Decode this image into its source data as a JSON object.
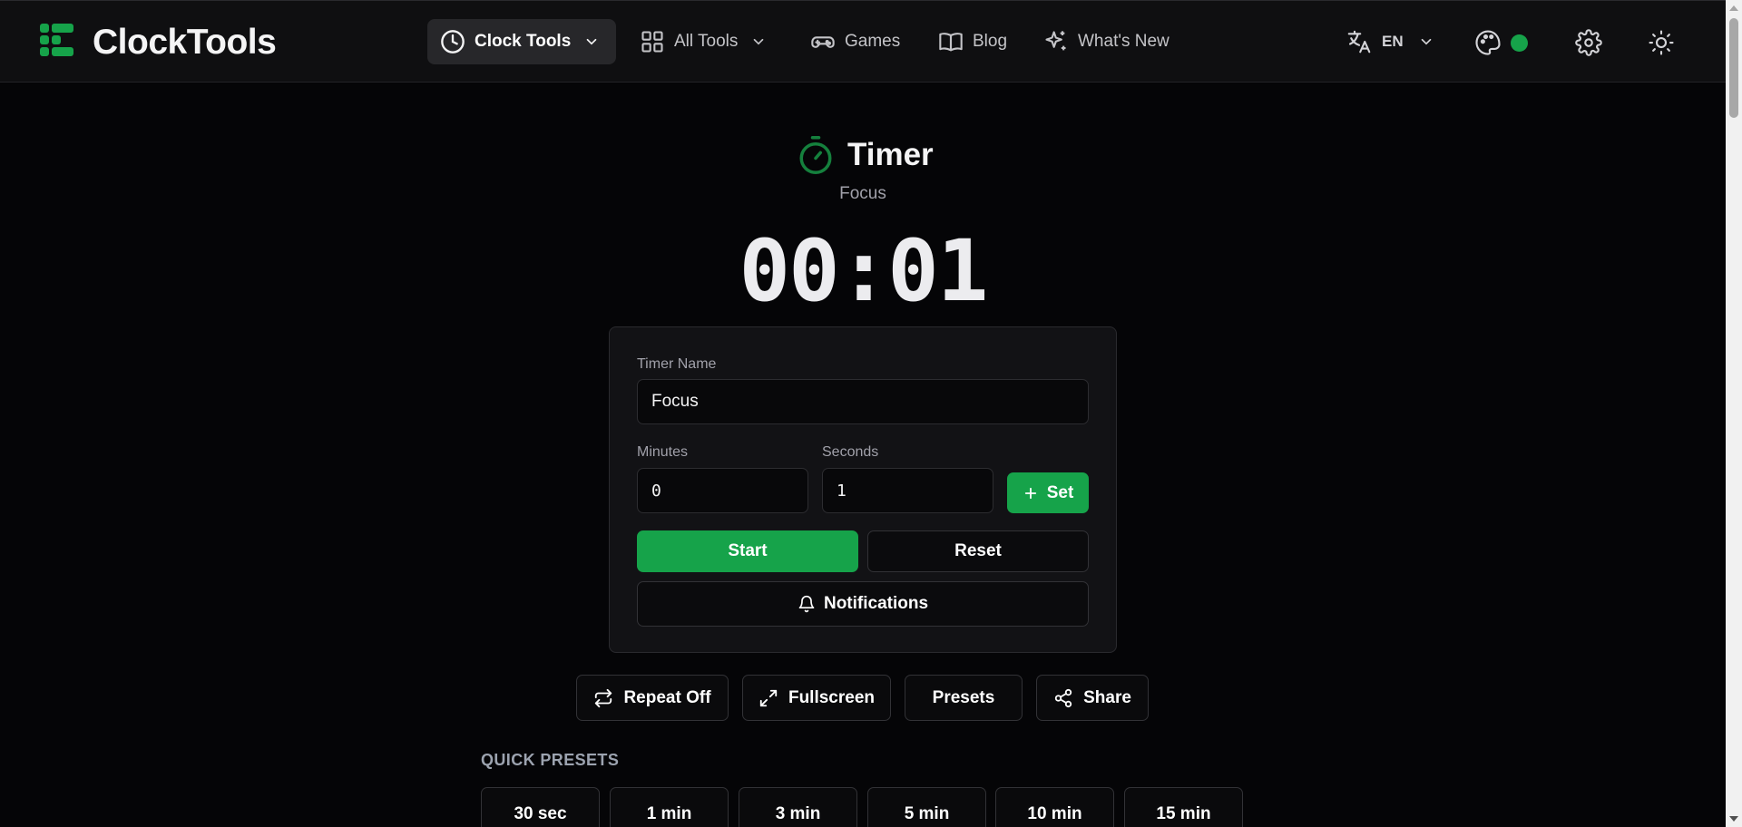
{
  "app": {
    "brand": "ClockTools",
    "accent_color": "#16a34a"
  },
  "nav": {
    "clock_tools": "Clock Tools",
    "all_tools": "All Tools",
    "games": "Games",
    "blog": "Blog",
    "whats_new": "What's New"
  },
  "header_right": {
    "language": "EN",
    "status_color": "#16a34a"
  },
  "timer": {
    "title": "Timer",
    "subtitle": "Focus",
    "display": "00:01"
  },
  "form": {
    "timer_name_label": "Timer Name",
    "timer_name_value": "Focus",
    "minutes_label": "Minutes",
    "minutes_value": "0",
    "seconds_label": "Seconds",
    "seconds_value": "1",
    "set_label": "Set",
    "start_label": "Start",
    "reset_label": "Reset",
    "notifications_label": "Notifications"
  },
  "actions": {
    "repeat": "Repeat Off",
    "fullscreen": "Fullscreen",
    "presets": "Presets",
    "share": "Share"
  },
  "quick_presets": {
    "title": "QUICK PRESETS",
    "items": [
      "30 sec",
      "1 min",
      "3 min",
      "5 min",
      "10 min",
      "15 min"
    ]
  }
}
